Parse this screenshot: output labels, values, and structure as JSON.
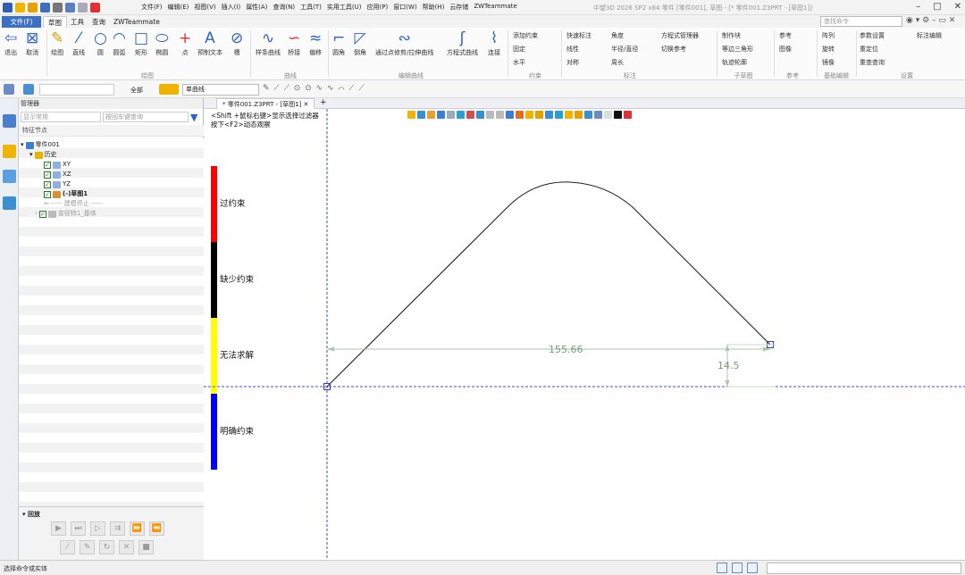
{
  "menus": [
    "文件(F)",
    "编辑(E)",
    "视图(V)",
    "插入(I)",
    "属性(A)",
    "查询(N)",
    "工具(T)",
    "实用工具(U)",
    "应用(P)",
    "窗口(W)",
    "帮助(H)",
    "云存储",
    "ZWTeammate"
  ],
  "window_title": "中望3D 2026 SP2 x64    零件 [零件001], 草图 - [* 零件001.Z3PRT - [草图1]]",
  "ribbon_tabs": {
    "file": "文件(F)",
    "sketch": "草图",
    "tools": "工具",
    "query": "查询",
    "team": "ZWTeammate"
  },
  "command_search_placeholder": "查找命令",
  "ribbon": {
    "exit": "退出",
    "cancel": "取消",
    "draw": "绘图",
    "line": "直线",
    "circle": "圆",
    "arc": "圆弧",
    "rect": "矩形",
    "ellipse": "椭圆",
    "point": "点",
    "text": "预制文本",
    "slot": "槽",
    "spline": "样条曲线",
    "bridge": "桥接",
    "offset": "偏移",
    "fillet": "圆角",
    "chamfer": "倒角",
    "via_point": "通过点修剪/拉伸曲线",
    "equation": "方程式曲线",
    "connect": "连接",
    "add_constraint": "添加约束",
    "fixed": "固定",
    "horizontal": "水平",
    "quick_dim": "快速标注",
    "linear": "线性",
    "symmetric": "对称",
    "angle": "角度",
    "radius": "半径/直径",
    "arc_len": "周长",
    "eq_manager": "方程式管理器",
    "toggle_ref": "切换参考",
    "make_block": "制作块",
    "iso_tri": "等边三角形",
    "track_contour": "轨迹轮廓",
    "reference": "参考",
    "image": "图像",
    "array": "阵列",
    "rotate": "旋转",
    "mirror": "镜像",
    "param_settings": "参数设置",
    "reposition": "重定位",
    "redo_query": "重查查询",
    "dim_edit": "标注编辑"
  },
  "ribbon_groups": {
    "exit": "退出",
    "draw": "绘图",
    "curve": "曲线",
    "edit_curve": "编辑曲线",
    "constraint": "约束",
    "dimension": "标注",
    "sub_sketch": "子草图",
    "reference": "参考",
    "basic_edit": "基础编辑",
    "settings": "设置"
  },
  "toolbar2": {
    "all": "全部",
    "curve_type": "单曲线"
  },
  "manager": {
    "title": "管理器",
    "filter_placeholder": "显示常用",
    "search_placeholder": "按回车键查询",
    "column": "特征节点",
    "tree": [
      {
        "label": "零件001"
      },
      {
        "label": "历史"
      },
      {
        "label": "XY"
      },
      {
        "label": "XZ"
      },
      {
        "label": "YZ"
      },
      {
        "label": "(-)草图1"
      },
      {
        "label": "----- 建模停止 -----"
      },
      {
        "label": "变径特1_基体"
      }
    ],
    "playback_title": "回放"
  },
  "doc_tab": "* 零件001.Z3PRT - [草图1]",
  "hint_lines": [
    "<Shift +鼠标右键>显示选择过滤器",
    "按下<F2>动态观察"
  ],
  "constraint_legend": [
    {
      "label": "过约束",
      "color": "#ff0000"
    },
    {
      "label": "缺少约束",
      "color": "#000000"
    },
    {
      "label": "无法求解",
      "color": "#ffff00"
    },
    {
      "label": "明确约束",
      "color": "#0000ff"
    }
  ],
  "dimensions": {
    "horizontal": "155.66",
    "vertical": "14.5"
  },
  "status": "选择命令或实体"
}
